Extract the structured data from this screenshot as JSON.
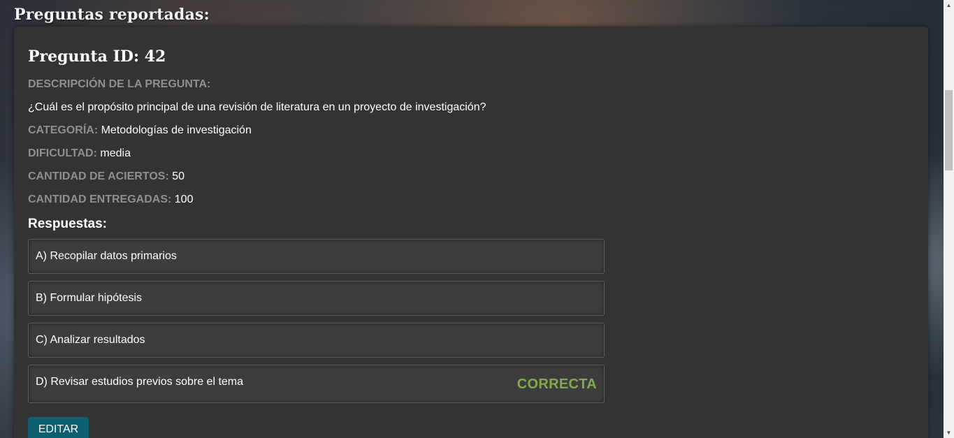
{
  "page": {
    "heading": "Preguntas reportadas:"
  },
  "question": {
    "title": "Pregunta ID: 42",
    "description_label": "DESCRIPCIÓN DE LA PREGUNTA:",
    "description_text": "¿Cuál es el propósito principal de una revisión de literatura en un proyecto de investigación?",
    "category_label": "CATEGORÍA:",
    "category_value": "Metodologías de investigación",
    "difficulty_label": "DIFICULTAD:",
    "difficulty_value": "media",
    "hits_label": "CANTIDAD DE ACIERTOS:",
    "hits_value": "50",
    "delivered_label": "CANTIDAD ENTREGADAS:",
    "delivered_value": "100"
  },
  "answers": {
    "title": "Respuestas:",
    "items": [
      {
        "text": "A) Recopilar datos primarios",
        "correct": false
      },
      {
        "text": "B) Formular hipótesis",
        "correct": false
      },
      {
        "text": "C) Analizar resultados",
        "correct": false
      },
      {
        "text": "D) Revisar estudios previos sobre el tema",
        "correct": true
      }
    ],
    "correct_badge": "CORRECTA"
  },
  "actions": {
    "edit_label": "EDITAR"
  },
  "colors": {
    "card_bg": "#333333",
    "label_gray": "#8f8f8f",
    "correct_green": "#84a84e",
    "edit_button": "#0f5f73"
  },
  "icons": {
    "scroll_up": "triangle-up-icon",
    "scroll_down": "triangle-down-icon"
  }
}
